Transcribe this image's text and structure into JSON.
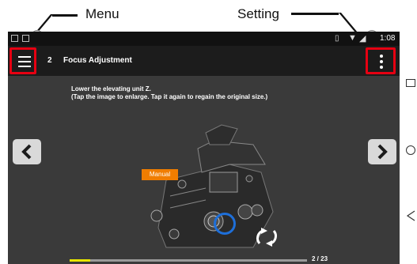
{
  "callouts": {
    "menu_label": "Menu",
    "setting_label": "Setting"
  },
  "status_bar": {
    "time": "1:08"
  },
  "app_bar": {
    "step_number": "2",
    "step_title": "Focus Adjustment"
  },
  "content": {
    "instruction_line1": "Lower the elevating unit Z.",
    "instruction_line2": "(Tap the image to enlarge. Tap it again to regain the original size.)",
    "mode_badge": "Manual",
    "page_indicator": "2 / 23",
    "progress": 0.087
  },
  "colors": {
    "highlight_red": "#e60012",
    "badge_orange": "#f07d00",
    "progress_yellow": "#e8e600",
    "focus_ring_blue": "#1e6fd9"
  },
  "icons": {
    "menu": "hamburger-icon",
    "settings": "kebab-menu-icon",
    "prev": "chevron-left-icon",
    "next": "chevron-right-icon",
    "rotate": "rotate-arrows-icon"
  }
}
